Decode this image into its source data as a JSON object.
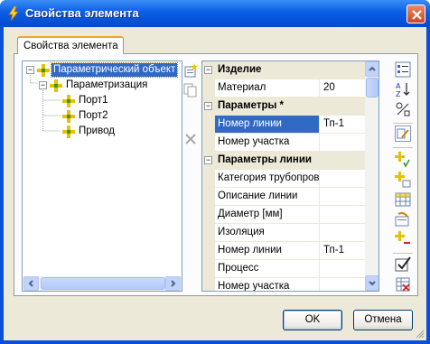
{
  "window": {
    "title": "Свойства элемента"
  },
  "tab": {
    "label": "Свойства элемента"
  },
  "tree": {
    "items": [
      {
        "label": "Параметрический объект"
      },
      {
        "label": "Параметризация"
      },
      {
        "label": "Порт1"
      },
      {
        "label": "Порт2"
      },
      {
        "label": "Привод"
      }
    ]
  },
  "grid": {
    "rows": [
      {
        "kind": "category",
        "label": "Изделие"
      },
      {
        "kind": "prop",
        "name": "Материал",
        "value": "20"
      },
      {
        "kind": "category",
        "label": "Параметры *"
      },
      {
        "kind": "prop",
        "name": "Номер линии",
        "value": "Тп-1"
      },
      {
        "kind": "prop",
        "name": "Номер участка",
        "value": ""
      },
      {
        "kind": "category",
        "label": "Параметры линии"
      },
      {
        "kind": "prop",
        "name": "Категория трубопрово...",
        "value": ""
      },
      {
        "kind": "prop",
        "name": "Описание линии",
        "value": ""
      },
      {
        "kind": "prop",
        "name": "Диаметр [мм]",
        "value": ""
      },
      {
        "kind": "prop",
        "name": "Изоляция",
        "value": ""
      },
      {
        "kind": "prop",
        "name": "Номер линии",
        "value": "Тп-1"
      },
      {
        "kind": "prop",
        "name": "Процесс",
        "value": ""
      },
      {
        "kind": "prop",
        "name": "Номер участка",
        "value": ""
      }
    ]
  },
  "buttons": {
    "ok": "OK",
    "cancel": "Отмена"
  },
  "colors": {
    "title_bar": "#0a5fe6",
    "selection": "#316ac5",
    "face": "#ece9d8"
  }
}
